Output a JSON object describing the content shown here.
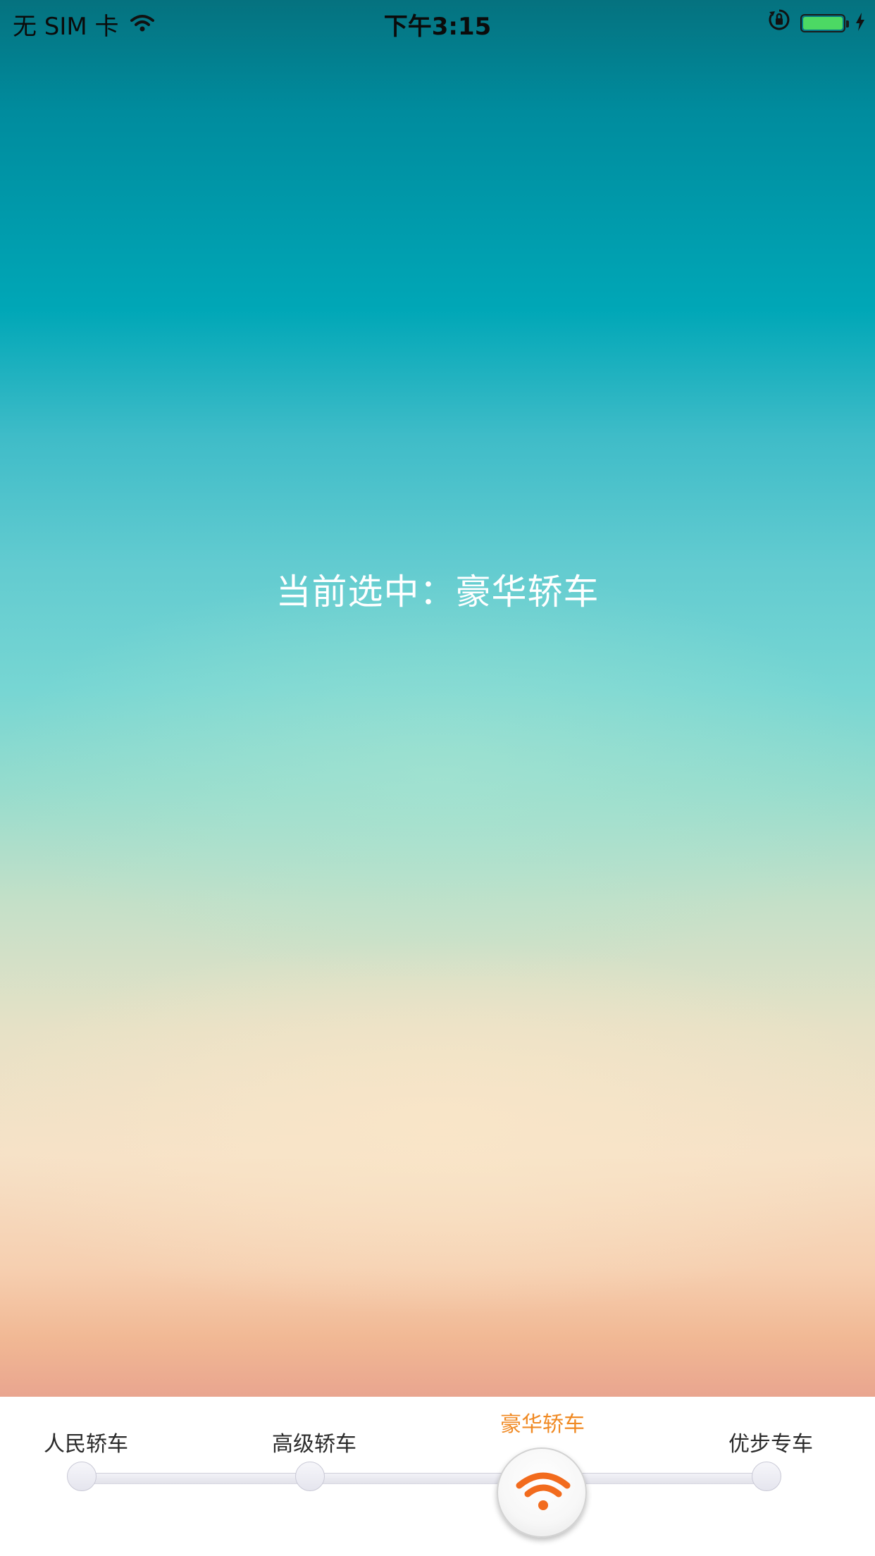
{
  "status_bar": {
    "carrier": "无 SIM 卡",
    "time": "下午3:15"
  },
  "main": {
    "selection_prefix": "当前选中：",
    "selection_value": "豪华轿车"
  },
  "selector": {
    "options": [
      {
        "label": "人民轿车"
      },
      {
        "label": "高级轿车"
      },
      {
        "label": "豪华轿车"
      },
      {
        "label": "优步专车"
      }
    ],
    "selected_index": 2,
    "active_color": "#f08a24"
  }
}
